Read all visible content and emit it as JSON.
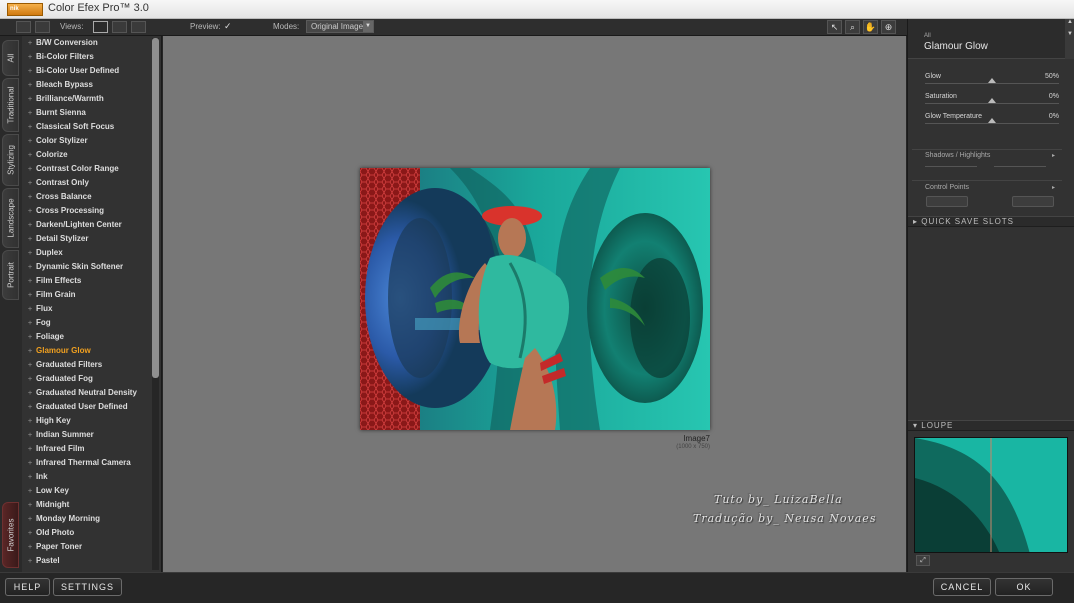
{
  "titlebar": {
    "app_title": "Color Efex Pro™ 3.0",
    "logo_text": "nik"
  },
  "toolbar": {
    "views_label": "Views:",
    "preview_label": "Preview:",
    "preview_checked": true,
    "modes_label": "Modes:",
    "mode_value": "Original Image",
    "tools": [
      "pointer-icon",
      "zoom-icon",
      "hand-icon",
      "control-point-icon"
    ]
  },
  "vtabs": [
    "All",
    "Traditional",
    "Stylizing",
    "Landscape",
    "Portrait"
  ],
  "favorites_tab": "Favorites",
  "filters": [
    "B/W Conversion",
    "Bi-Color Filters",
    "Bi-Color User Defined",
    "Bleach Bypass",
    "Brilliance/Warmth",
    "Burnt Sienna",
    "Classical Soft Focus",
    "Color Stylizer",
    "Colorize",
    "Contrast Color Range",
    "Contrast Only",
    "Cross Balance",
    "Cross Processing",
    "Darken/Lighten Center",
    "Detail Stylizer",
    "Duplex",
    "Dynamic Skin Softener",
    "Film Effects",
    "Film Grain",
    "Flux",
    "Fog",
    "Foliage",
    "Glamour Glow",
    "Graduated Filters",
    "Graduated Fog",
    "Graduated Neutral Density",
    "Graduated User Defined",
    "High Key",
    "Indian Summer",
    "Infrared Film",
    "Infrared Thermal Camera",
    "Ink",
    "Low Key",
    "Midnight",
    "Monday Morning",
    "Old Photo",
    "Paper Toner",
    "Pastel"
  ],
  "active_filter_index": 22,
  "preview": {
    "image_name": "Image7",
    "image_size": "(1000 x 750)"
  },
  "watermark": {
    "line1": "Tuto by_ LuizaBella",
    "line2": "Tradução by_ Neusa Novaes"
  },
  "panel": {
    "category": "All",
    "filter_name": "Glamour Glow",
    "sliders": [
      {
        "label": "Glow",
        "value": "50%",
        "level": 0.5
      },
      {
        "label": "Saturation",
        "value": "0%",
        "level": 0.5
      },
      {
        "label": "Glow Temperature",
        "value": "0%",
        "level": 0.5
      }
    ],
    "shadows_highlights": "Shadows / Highlights",
    "control_points": "Control Points",
    "quick_save": "QUICK SAVE SLOTS",
    "loupe": "LOUPE"
  },
  "buttons": {
    "help": "HELP",
    "settings": "SETTINGS",
    "cancel": "CANCEL",
    "ok": "OK"
  }
}
